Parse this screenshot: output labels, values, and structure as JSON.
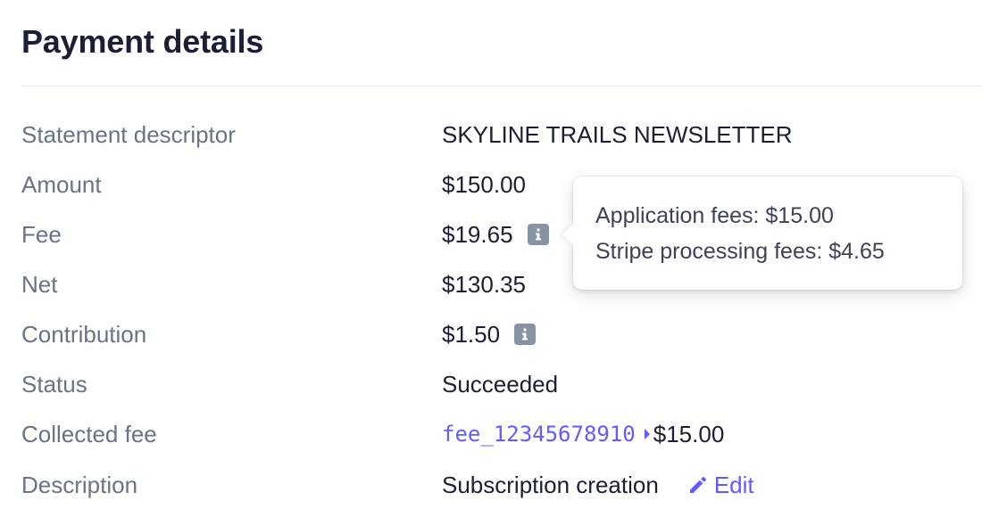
{
  "header": {
    "title": "Payment details"
  },
  "details": [
    {
      "label": "Statement descriptor",
      "value": "SKYLINE TRAILS NEWSLETTER"
    },
    {
      "label": "Amount",
      "value": "$150.00"
    },
    {
      "label": "Fee",
      "value": "$19.65"
    },
    {
      "label": "Net",
      "value": "$130.35"
    },
    {
      "label": "Contribution",
      "value": "$1.50"
    },
    {
      "label": "Status",
      "value": "Succeeded"
    },
    {
      "label": "Collected fee",
      "fee_id": "fee_12345678910",
      "value": "$15.00"
    },
    {
      "label": "Description",
      "value": "Subscription creation",
      "edit_label": "Edit"
    }
  ],
  "tooltip": {
    "lines": [
      {
        "label": "Application fees:",
        "value": "$15.00"
      },
      {
        "label": "Stripe processing fees:",
        "value": "$4.65"
      }
    ]
  },
  "icons": {
    "info": "info-icon",
    "edit": "pencil-icon",
    "caret": "caret-right-icon"
  },
  "colors": {
    "accent": "#635bff",
    "label": "#697386",
    "text": "#1a1f36",
    "icon_bg": "#8792a2"
  }
}
